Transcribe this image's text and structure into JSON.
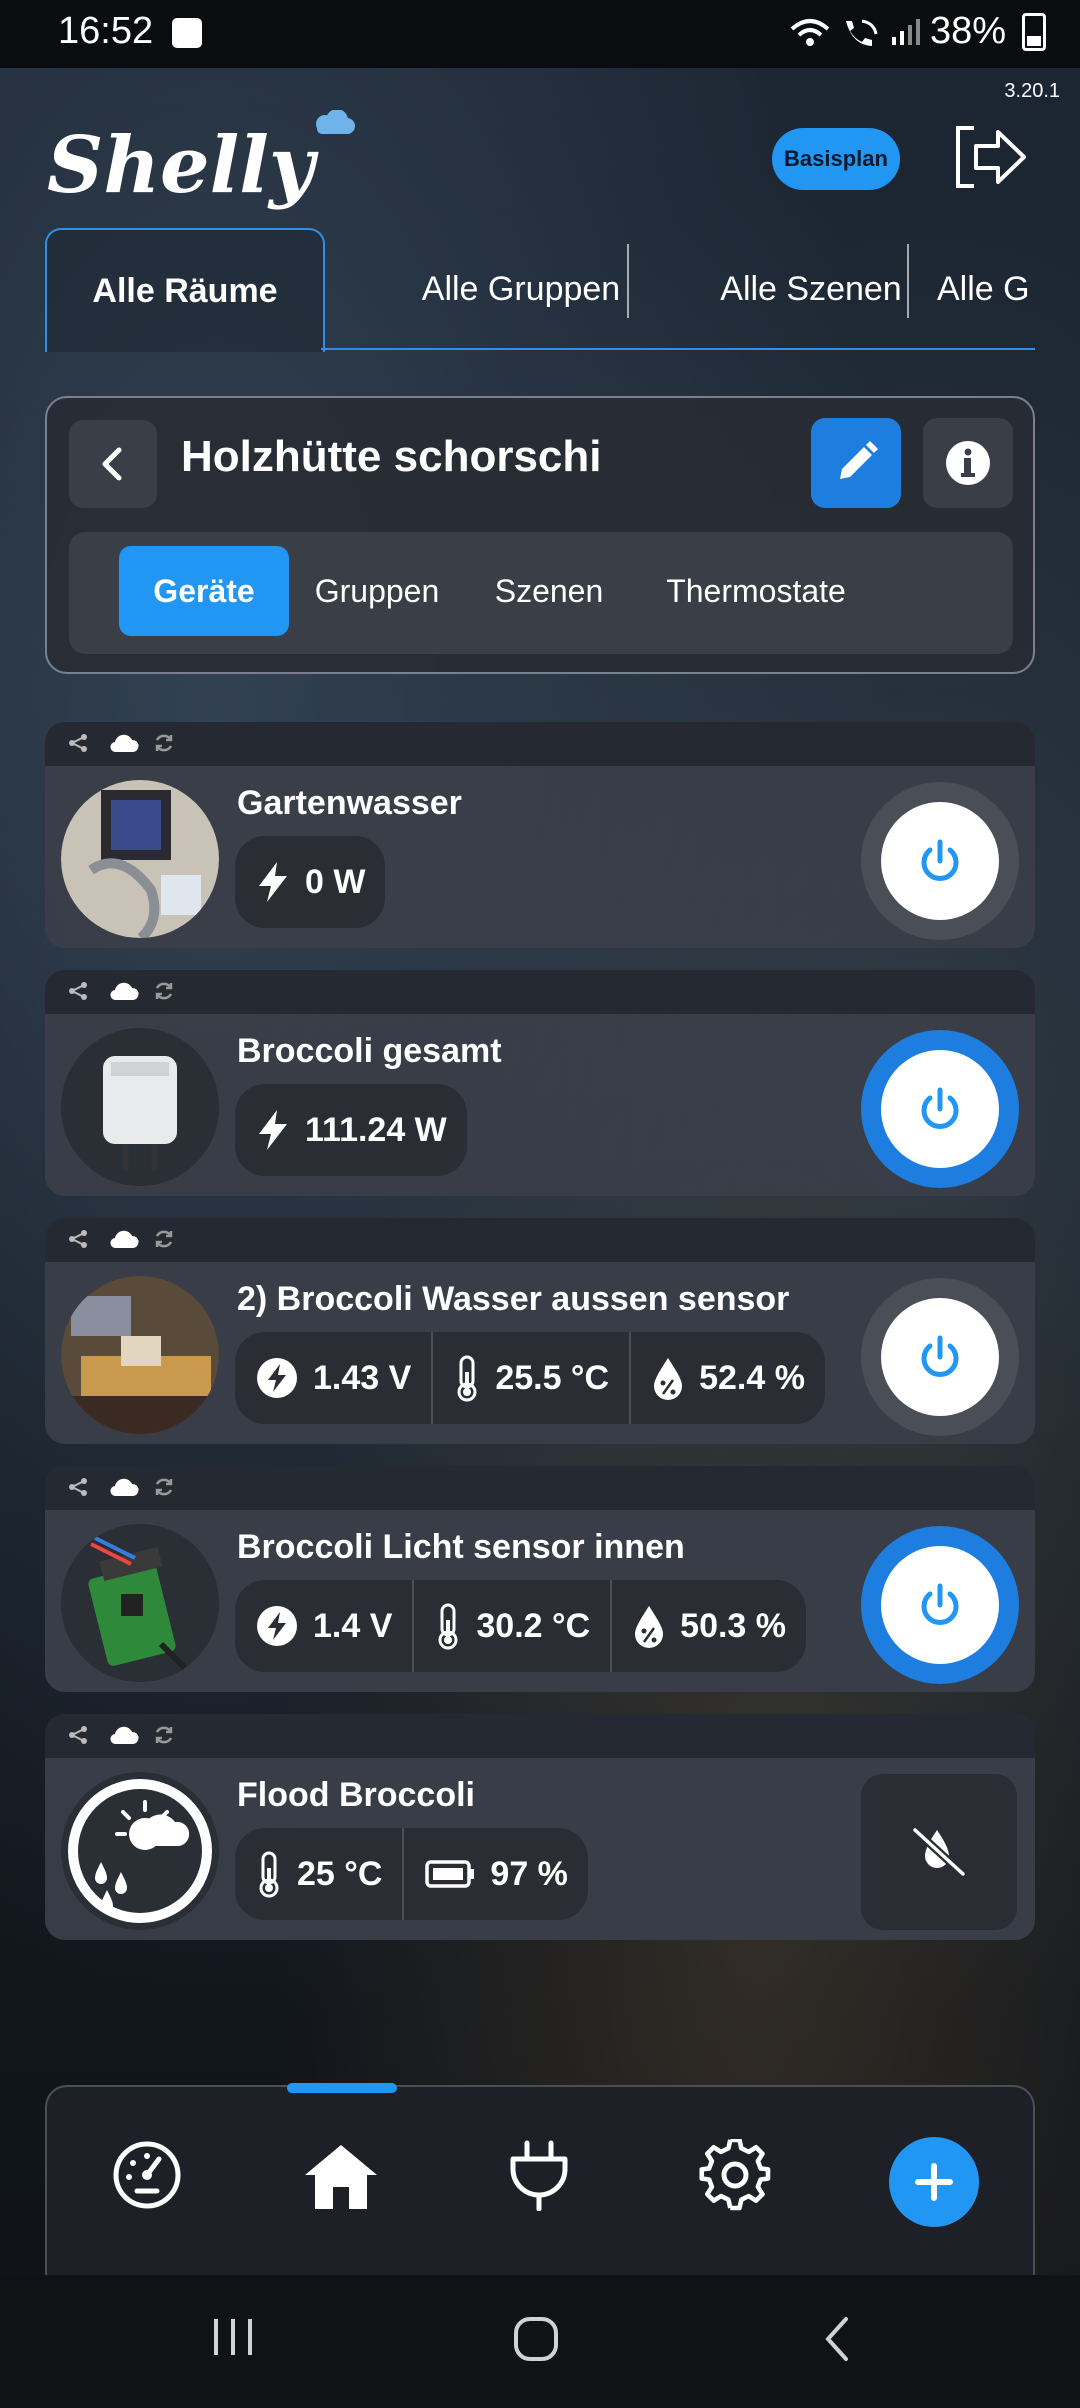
{
  "status_bar": {
    "time": "16:52",
    "battery": "38%"
  },
  "app": {
    "version": "3.20.1",
    "logo_text": "Shelly",
    "plan_label": "Basisplan"
  },
  "top_tabs": [
    "Alle Räume",
    "Alle Gruppen",
    "Alle Szenen",
    "Alle G"
  ],
  "room": {
    "title": "Holzhütte schorschi",
    "subtabs": [
      "Geräte",
      "Gruppen",
      "Szenen",
      "Thermostate"
    ],
    "active_subtab": "Geräte"
  },
  "devices": [
    {
      "name": "Gartenwasser",
      "readings": [
        {
          "icon": "bolt-icon",
          "value": "0 W"
        }
      ],
      "power_on": false
    },
    {
      "name": "Broccoli gesamt",
      "readings": [
        {
          "icon": "bolt-icon",
          "value": "111.24 W"
        }
      ],
      "power_on": true
    },
    {
      "name": "2) Broccoli Wasser aussen sensor",
      "readings": [
        {
          "icon": "voltage-icon",
          "value": "1.43 V"
        },
        {
          "icon": "thermometer-icon",
          "value": "25.5 °C"
        },
        {
          "icon": "humidity-icon",
          "value": "52.4 %"
        }
      ],
      "power_on": false
    },
    {
      "name": "Broccoli Licht sensor innen",
      "readings": [
        {
          "icon": "voltage-icon",
          "value": "1.4 V"
        },
        {
          "icon": "thermometer-icon",
          "value": "30.2 °C"
        },
        {
          "icon": "humidity-icon",
          "value": "50.3 %"
        }
      ],
      "power_on": true
    },
    {
      "name": "Flood Broccoli",
      "readings": [
        {
          "icon": "thermometer-icon",
          "value": "25 °C"
        },
        {
          "icon": "battery-icon",
          "value": "97 %"
        }
      ],
      "action_icon": "flood-off-icon"
    }
  ],
  "bottom_nav": [
    "dashboard-icon",
    "home-icon",
    "plug-icon",
    "settings-icon",
    "add-icon"
  ],
  "colors": {
    "accent": "#2196f3",
    "card": "#3a3e48",
    "pill": "#2a2d33"
  }
}
